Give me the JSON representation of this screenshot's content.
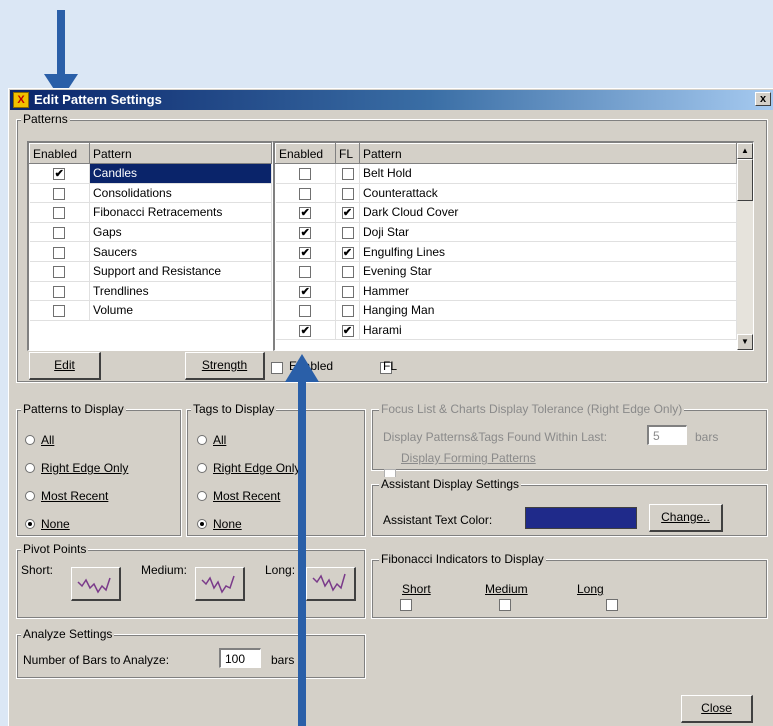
{
  "window": {
    "title": "Edit Pattern Settings",
    "close_glyph": "x"
  },
  "patterns": {
    "group_label": "Patterns",
    "left_table": {
      "headers": [
        "Enabled",
        "Pattern"
      ],
      "rows": [
        {
          "label": "Candles",
          "enabled": true,
          "selected": true
        },
        {
          "label": "Consolidations",
          "enabled": false
        },
        {
          "label": "Fibonacci Retracements",
          "enabled": false
        },
        {
          "label": "Gaps",
          "enabled": false
        },
        {
          "label": "Saucers",
          "enabled": false
        },
        {
          "label": "Support and Resistance",
          "enabled": false
        },
        {
          "label": "Trendlines",
          "enabled": false
        },
        {
          "label": "Volume",
          "enabled": false
        }
      ]
    },
    "right_table": {
      "headers": [
        "Enabled",
        "FL",
        "Pattern"
      ],
      "rows": [
        {
          "label": "Belt Hold",
          "enabled": false,
          "fl": false
        },
        {
          "label": "Counterattack",
          "enabled": false,
          "fl": false
        },
        {
          "label": "Dark Cloud Cover",
          "enabled": true,
          "fl": true
        },
        {
          "label": "Doji Star",
          "enabled": true,
          "fl": false
        },
        {
          "label": "Engulfing Lines",
          "enabled": true,
          "fl": true
        },
        {
          "label": "Evening Star",
          "enabled": false,
          "fl": false
        },
        {
          "label": "Hammer",
          "enabled": true,
          "fl": false
        },
        {
          "label": "Hanging Man",
          "enabled": false,
          "fl": false
        },
        {
          "label": "Harami",
          "enabled": true,
          "fl": true
        }
      ]
    },
    "edit_button": "Edit",
    "strength_button": "Strength",
    "enabled_check": "Enabled",
    "fl_check": "FL"
  },
  "patterns_to_display": {
    "label": "Patterns to Display",
    "options": [
      "All",
      "Right Edge Only",
      "Most Recent",
      "None"
    ],
    "selected": "None"
  },
  "tags_to_display": {
    "label": "Tags to Display",
    "options": [
      "All",
      "Right Edge Only",
      "Most Recent",
      "None"
    ],
    "selected": "None"
  },
  "focus_list": {
    "label": "Focus List & Charts Display Tolerance (Right Edge Only)",
    "display_text": "Display Patterns&Tags Found Within Last:",
    "value": "5",
    "unit": "bars",
    "forming_check": "Display Forming Patterns"
  },
  "assistant": {
    "label": "Assistant Display Settings",
    "text_color_label": "Assistant Text Color:",
    "color": "#1f2a8a",
    "change_button": "Change.."
  },
  "pivot_points": {
    "label": "Pivot Points",
    "short": "Short:",
    "medium": "Medium:",
    "long": "Long:"
  },
  "fibonacci": {
    "label": "Fibonacci Indicators to Display",
    "options": [
      "Short",
      "Medium",
      "Long"
    ]
  },
  "analyze": {
    "label": "Analyze Settings",
    "bars_label": "Number of Bars to Analyze:",
    "value": "100",
    "unit": "bars"
  },
  "close_button": "Close",
  "arrow_color": "#2a5fa8"
}
